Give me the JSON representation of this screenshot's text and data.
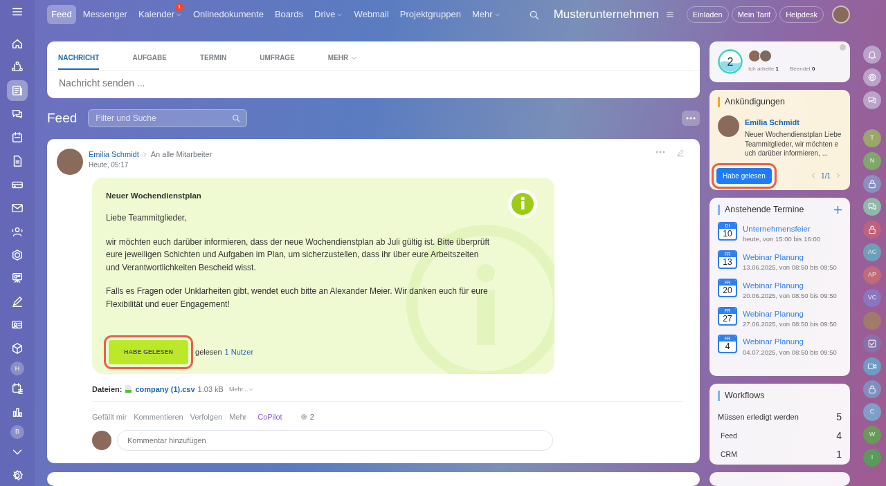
{
  "sidebar": {
    "items": [
      {
        "kind": "icon",
        "selected": false
      },
      {
        "kind": "icon",
        "selected": false
      },
      {
        "kind": "icon",
        "selected": true
      },
      {
        "kind": "icon",
        "selected": false
      },
      {
        "kind": "icon",
        "selected": false
      },
      {
        "kind": "icon",
        "selected": false
      },
      {
        "kind": "icon",
        "selected": false
      },
      {
        "kind": "icon",
        "selected": false
      },
      {
        "kind": "icon",
        "selected": false
      },
      {
        "kind": "icon",
        "selected": false
      },
      {
        "kind": "icon",
        "selected": false
      },
      {
        "kind": "icon",
        "selected": false
      },
      {
        "kind": "icon",
        "selected": false
      },
      {
        "kind": "icon",
        "selected": false
      },
      {
        "kind": "letter",
        "label": "H",
        "selected": false
      },
      {
        "kind": "icon",
        "selected": false
      },
      {
        "kind": "icon",
        "selected": false
      },
      {
        "kind": "letter",
        "label": "B",
        "selected": false
      },
      {
        "kind": "icon",
        "selected": false
      },
      {
        "kind": "icon",
        "selected": false
      }
    ]
  },
  "topnav": {
    "items": [
      {
        "label": "Feed",
        "selected": true,
        "dropdown": false
      },
      {
        "label": "Messenger",
        "selected": false,
        "dropdown": false
      },
      {
        "label": "Kalender",
        "selected": false,
        "dropdown": true,
        "badge": "1"
      },
      {
        "label": "Onlinedokumente",
        "selected": false,
        "dropdown": false
      },
      {
        "label": "Boards",
        "selected": false,
        "dropdown": false
      },
      {
        "label": "Drive",
        "selected": false,
        "dropdown": true
      },
      {
        "label": "Webmail",
        "selected": false,
        "dropdown": false
      },
      {
        "label": "Projektgruppen",
        "selected": false,
        "dropdown": false
      },
      {
        "label": "Mehr",
        "selected": false,
        "dropdown": true
      }
    ],
    "company": "Musterunternehmen",
    "buttons": [
      "Einladen",
      "Mein Tarif",
      "Helpdesk"
    ]
  },
  "composer": {
    "tabs": [
      {
        "label": "NACHRICHT",
        "selected": true,
        "dropdown": false
      },
      {
        "label": "AUFGABE",
        "selected": false,
        "dropdown": false
      },
      {
        "label": "TERMIN",
        "selected": false,
        "dropdown": false
      },
      {
        "label": "UMFRAGE",
        "selected": false,
        "dropdown": false
      },
      {
        "label": "MEHR",
        "selected": false,
        "dropdown": true
      }
    ],
    "placeholder": "Nachricht senden ..."
  },
  "feed": {
    "title": "Feed",
    "search_placeholder": "Filter und Suche"
  },
  "post": {
    "author": "Emilia Schmidt",
    "recipient": "An alle Mitarbeiter",
    "time": "Heute, 05:17",
    "message": {
      "title": "Neuer Wochendienstplan",
      "paragraphs": [
        "Liebe Teammitglieder,",
        "wir möchten euch darüber informieren, dass der neue Wochendienstplan ab Juli gültig ist. Bitte überprüft eure jeweiligen Schichten und Aufgaben im Plan, um sicherzustellen, dass ihr über eure Arbeitszeiten und Verantwortlichkeiten Bescheid wisst.",
        "Falls es Fragen oder Unklarheiten gibt, wendet euch bitte an Alexander Meier. Wir danken euch für eure Flexibilität und euer Engagement!"
      ],
      "read_button": {
        "label": "HABE GELESEN",
        "highlighted": true
      },
      "read_text": "gelesen",
      "read_link": "1 Nutzer"
    },
    "files_label": "Dateien:",
    "file": "company (1).csv",
    "file_size": "1.03 kB",
    "files_more": "Mehr...",
    "actions": [
      {
        "label": "Gefällt mir",
        "kind": "plain"
      },
      {
        "label": "Kommentieren",
        "kind": "plain"
      },
      {
        "label": "Verfolgen",
        "kind": "plain"
      },
      {
        "label": "Mehr",
        "kind": "plain"
      },
      {
        "label": "CoPilot",
        "kind": "ai"
      }
    ],
    "views": "2",
    "comment_placeholder": "Kommentar hinzufügen"
  },
  "worktime": {
    "count": "2",
    "working_label": "Ich arbeite",
    "working": "1",
    "done_label": "Beendet",
    "done": "0"
  },
  "announcements": {
    "title": "Ankündigungen",
    "author": "Emilia Schmidt",
    "text": "Neuer Wochendienstplan Liebe Teammitglieder, wir möchten euch darüber informieren, ...",
    "button": {
      "label": "Habe gelesen",
      "highlighted": true
    },
    "pager": "1/1"
  },
  "events": {
    "title": "Anstehende Termine",
    "items": [
      {
        "weekday": "DI",
        "day": "10",
        "title": "Unternehmensfeier",
        "time": "heute, von 15:00 bis 16:00"
      },
      {
        "weekday": "FR",
        "day": "13",
        "title": "Webinar Planung",
        "time": "13.06.2025, von 08:50 bis 09:50"
      },
      {
        "weekday": "FR",
        "day": "20",
        "title": "Webinar Planung",
        "time": "20.06.2025, von 08:50 bis 09:50"
      },
      {
        "weekday": "FR",
        "day": "27",
        "title": "Webinar Planung",
        "time": "27.06.2025, von 08:50 bis 09:50"
      },
      {
        "weekday": "FR",
        "day": "4",
        "title": "Webinar Planung",
        "time": "04.07.2025, von 08:50 bis 09:50"
      }
    ]
  },
  "workflows": {
    "title": "Workflows",
    "rows": [
      {
        "label": "Müssen erledigt werden",
        "count": "5",
        "kind": "total"
      },
      {
        "label": "Feed",
        "count": "4",
        "kind": "sub"
      },
      {
        "label": "CRM",
        "count": "1",
        "kind": "sub"
      }
    ]
  },
  "right_rail": {
    "items": [
      {
        "kind": "icon",
        "color": "#b9a3c9"
      },
      {
        "kind": "icon",
        "color": "#b9a3c9"
      },
      {
        "kind": "icon",
        "color": "#b9a3c9"
      },
      {
        "kind": "letter",
        "label": "T",
        "color": "#9aa66a"
      },
      {
        "kind": "letter",
        "label": "N",
        "color": "#7fa86a"
      },
      {
        "kind": "icon",
        "color": "#8a8fc0"
      },
      {
        "kind": "icon",
        "color": "#8fb8a8"
      },
      {
        "kind": "icon",
        "color": "#c0607a"
      },
      {
        "kind": "letter",
        "label": "AC",
        "color": "#6f9fb8"
      },
      {
        "kind": "letter",
        "label": "AP",
        "color": "#c06a7a"
      },
      {
        "kind": "letter",
        "label": "VC",
        "color": "#8a76c0"
      },
      {
        "kind": "avatar",
        "color": "#a07a6a"
      },
      {
        "kind": "icon",
        "color": "#8a70a8"
      },
      {
        "kind": "icon",
        "color": "#6f9ac8"
      },
      {
        "kind": "icon",
        "color": "#7f8fc0"
      },
      {
        "kind": "letter",
        "label": "C",
        "color": "#7f9fc8"
      },
      {
        "kind": "letter",
        "label": "W",
        "color": "#6a9a5a"
      },
      {
        "kind": "letter",
        "label": "I",
        "color": "#5a9a5a"
      }
    ]
  }
}
